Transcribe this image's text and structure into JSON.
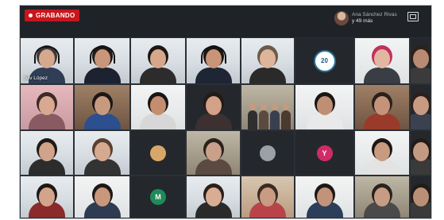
{
  "recording": {
    "label": "GRABANDO"
  },
  "presenter": {
    "name": "Ana Sánchez Rivas",
    "subtitle": "y 49 más"
  },
  "tiles": [
    {
      "kind": "person",
      "bg": "office",
      "skin": "#d6a88c",
      "hair": "#3a3a3a",
      "shirt": "#2f3d55",
      "headset": true,
      "label": "Silv López"
    },
    {
      "kind": "person",
      "bg": "office",
      "skin": "#c9967a",
      "hair": "#1f1a17",
      "shirt": "#1c2230",
      "headset": true,
      "label": ""
    },
    {
      "kind": "person",
      "bg": "office",
      "skin": "#d7a78b",
      "hair": "#1d1714",
      "shirt": "#2c2c2c",
      "headset": false,
      "label": ""
    },
    {
      "kind": "person",
      "bg": "office",
      "skin": "#c99478",
      "hair": "#191513",
      "shirt": "#1e2636",
      "headset": true,
      "label": ""
    },
    {
      "kind": "person",
      "bg": "office",
      "skin": "#deb49a",
      "hair": "#6a5a4a",
      "shirt": "#2a2a2a",
      "headset": false,
      "label": ""
    },
    {
      "kind": "logo",
      "bg": "dark",
      "text": "20",
      "label": ""
    },
    {
      "kind": "person",
      "bg": "white",
      "skin": "#e2b7a2",
      "hair": "#c0325a",
      "shirt": "#3a3d44",
      "headset": false,
      "label": ""
    },
    {
      "kind": "person",
      "bg": "dark",
      "skin": "#b88b72",
      "hair": "#2a221c",
      "shirt": "#3b3b3b",
      "headset": false,
      "label": ""
    },
    {
      "kind": "person",
      "bg": "pink",
      "skin": "#d8a892",
      "hair": "#3d2a22",
      "shirt": "#8a5a62",
      "headset": false,
      "label": ""
    },
    {
      "kind": "person",
      "bg": "wood",
      "skin": "#c79a7f",
      "hair": "#1b1715",
      "shirt": "#2b4f8f",
      "headset": false,
      "label": ""
    },
    {
      "kind": "person",
      "bg": "white",
      "skin": "#c48d70",
      "hair": "#1a1613",
      "shirt": "#d7d7d7",
      "headset": false,
      "label": ""
    },
    {
      "kind": "person",
      "bg": "dark",
      "skin": "#d3a088",
      "hair": "#241a16",
      "shirt": "#3c3030",
      "headset": false,
      "label": ""
    },
    {
      "kind": "group",
      "bg": "room",
      "label": ""
    },
    {
      "kind": "person",
      "bg": "white",
      "skin": "#c08f73",
      "hair": "#1a1715",
      "shirt": "#e9e9e9",
      "headset": false,
      "label": ""
    },
    {
      "kind": "person",
      "bg": "wood",
      "skin": "#c4937a",
      "hair": "#2a201b",
      "shirt": "#9a3a2a",
      "headset": false,
      "label": ""
    },
    {
      "kind": "person",
      "bg": "dark",
      "skin": "#c79b82",
      "hair": "#2a201b",
      "shirt": "#3a4150",
      "headset": false,
      "label": ""
    },
    {
      "kind": "person",
      "bg": "office",
      "skin": "#d0a38a",
      "hair": "#201a16",
      "shirt": "#2c2c2c",
      "headset": false,
      "label": ""
    },
    {
      "kind": "person",
      "bg": "office",
      "skin": "#d5aa90",
      "hair": "#5a3f30",
      "shirt": "#333333",
      "headset": false,
      "label": ""
    },
    {
      "kind": "avatar",
      "bg": "dark",
      "color": "#d9a66a",
      "text": "",
      "label": ""
    },
    {
      "kind": "person",
      "bg": "room",
      "skin": "#caa08a",
      "hair": "#2a221d",
      "shirt": "#5a4a42",
      "headset": false,
      "label": ""
    },
    {
      "kind": "avatar",
      "bg": "dark",
      "color": "#9aa0a6",
      "text": "",
      "label": ""
    },
    {
      "kind": "avatar",
      "bg": "dark",
      "color": "#d12b66",
      "text": "Y",
      "label": ""
    },
    {
      "kind": "person",
      "bg": "white",
      "skin": "#c89a80",
      "hair": "#1c1714",
      "shirt": "#e3e3e3",
      "headset": false,
      "label": ""
    },
    {
      "kind": "person",
      "bg": "dark",
      "skin": "#c49a82",
      "hair": "#221b17",
      "shirt": "#3a3a3a",
      "headset": false,
      "label": ""
    },
    {
      "kind": "person",
      "bg": "office",
      "skin": "#d2a58b",
      "hair": "#1e1815",
      "shirt": "#8a2a2a",
      "headset": false,
      "label": ""
    },
    {
      "kind": "person",
      "bg": "white",
      "skin": "#c9977c",
      "hair": "#1d1815",
      "shirt": "#2f3b52",
      "headset": false,
      "label": ""
    },
    {
      "kind": "avatar",
      "bg": "dark",
      "color": "#1f8a5a",
      "text": "M",
      "label": ""
    },
    {
      "kind": "person",
      "bg": "office",
      "skin": "#d9ad93",
      "hair": "#2a1f1a",
      "shirt": "#2a2a2a",
      "headset": false,
      "label": ""
    },
    {
      "kind": "person",
      "bg": "warm",
      "skin": "#c89b82",
      "hair": "#3a2c24",
      "shirt": "#b8444a",
      "headset": false,
      "label": ""
    },
    {
      "kind": "person",
      "bg": "white",
      "skin": "#c1937a",
      "hair": "#1e1815",
      "shirt": "#2c3e5a",
      "headset": false,
      "label": ""
    },
    {
      "kind": "person",
      "bg": "room",
      "skin": "#c79c85",
      "hair": "#2a221d",
      "shirt": "#4a4a4a",
      "headset": false,
      "label": ""
    },
    {
      "kind": "person",
      "bg": "dark",
      "skin": "#b99076",
      "hair": "#221b17",
      "shirt": "#3a3a3a",
      "headset": false,
      "label": ""
    }
  ]
}
